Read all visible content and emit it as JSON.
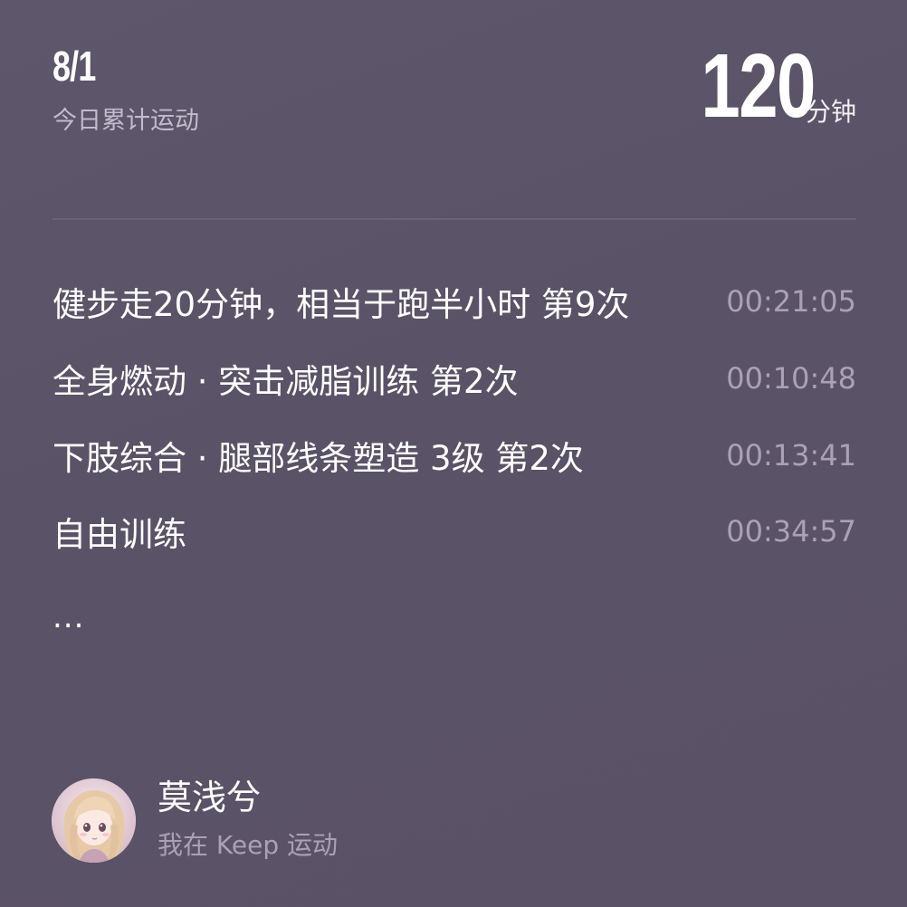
{
  "header": {
    "date": "8/1",
    "subtitle": "今日累计运动",
    "total_value": "120",
    "total_unit": "分钟"
  },
  "workouts": [
    {
      "name": "健步走20分钟，相当于跑半小时 第9次",
      "time": "00:21:05"
    },
    {
      "name": "全身燃动 · 突击减脂训练 第2次",
      "time": "00:10:48"
    },
    {
      "name": "下肢综合 · 腿部线条塑造 3级 第2次",
      "time": "00:13:41"
    },
    {
      "name": "自由训练",
      "time": "00:34:57"
    }
  ],
  "more": "...",
  "user": {
    "name": "莫浅兮",
    "subtitle": "我在 Keep 运动",
    "avatar_icon": "anime-girl-avatar"
  },
  "colors": {
    "background": "#5b5367",
    "secondary_text": "#aaa2b4",
    "divider": "#6b6478"
  }
}
